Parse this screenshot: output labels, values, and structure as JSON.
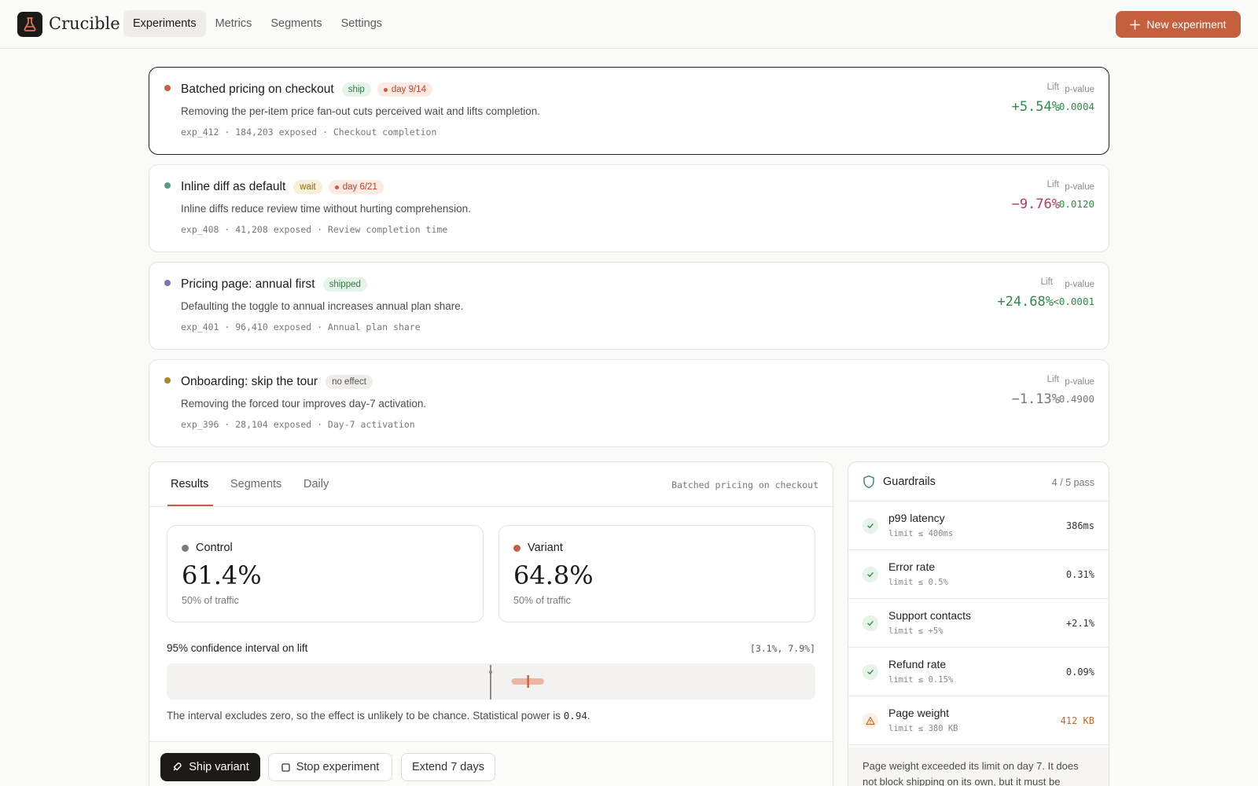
{
  "app": {
    "name": "Crucible"
  },
  "nav": {
    "tabs": [
      {
        "label": "Experiments",
        "active": true
      },
      {
        "label": "Metrics",
        "active": false
      },
      {
        "label": "Segments",
        "active": false
      },
      {
        "label": "Settings",
        "active": false
      }
    ],
    "new_button": "New experiment"
  },
  "experiments": [
    {
      "title": "Batched pricing on checkout",
      "status": "ship",
      "day": "day 9/14",
      "description": "Removing the per-item price fan-out cuts perceived wait and lifts completion.",
      "meta": "exp_412 · 184,203 exposed · Checkout completion",
      "lift_label": "Lift",
      "lift": "+5.54%",
      "p_label": "p-value",
      "p_value": "0.0004",
      "dot_color": "#c4603e",
      "lift_color": "#2e8a4b",
      "p_color": "#2e8a4b"
    },
    {
      "title": "Inline diff as default",
      "status": "wait",
      "day": "day 6/21",
      "description": "Inline diffs reduce review time without hurting comprehension.",
      "meta": "exp_408 · 41,208 exposed · Review completion time",
      "lift_label": "Lift",
      "lift": "−9.76%",
      "p_label": "p-value",
      "p_value": "0.0120",
      "dot_color": "#5a9a86",
      "lift_color": "#b8375e",
      "p_color": "#2e8a4b"
    },
    {
      "title": "Pricing page: annual first",
      "status": "shipped",
      "day": "",
      "description": "Defaulting the toggle to annual increases annual plan share.",
      "meta": "exp_401 · 96,410 exposed · Annual plan share",
      "lift_label": "Lift",
      "lift": "+24.68%",
      "p_label": "p-value",
      "p_value": "<0.0001",
      "dot_color": "#7f72b0",
      "lift_color": "#2e8a4b",
      "p_color": "#2e8a4b"
    },
    {
      "title": "Onboarding: skip the tour",
      "status": "no effect",
      "day": "",
      "description": "Removing the forced tour improves day-7 activation.",
      "meta": "exp_396 · 28,104 exposed · Day-7 activation",
      "lift_label": "Lift",
      "lift": "−1.13%",
      "p_label": "p-value",
      "p_value": "0.4900",
      "dot_color": "#a8882a",
      "lift_color": "#777777",
      "p_color": "#777777"
    }
  ],
  "results": {
    "tabs": [
      {
        "label": "Results",
        "active": true
      },
      {
        "label": "Segments",
        "active": false
      },
      {
        "label": "Daily",
        "active": false
      }
    ],
    "selected_experiment": "Batched pricing on checkout",
    "control": {
      "label": "Control",
      "value": "61.4%",
      "traffic": "50% of traffic",
      "color": "#7a7a7a"
    },
    "variant": {
      "label": "Variant",
      "value": "64.8%",
      "traffic": "50% of traffic",
      "color": "#c4603e"
    },
    "ci": {
      "label": "95% confidence interval on lift",
      "range": "[3.1%, 7.9%]",
      "low": 3.1,
      "high": 7.9,
      "point": 5.54
    },
    "note_prefix": "The interval excludes zero, so the effect is unlikely to be chance. Statistical power is ",
    "power": "0.94",
    "note_suffix": ".",
    "actions": {
      "ship": "Ship variant",
      "stop": "Stop experiment",
      "extend": "Extend 7 days"
    }
  },
  "guardrails": {
    "title": "Guardrails",
    "count": "4 / 5 pass",
    "items": [
      {
        "name": "p99 latency",
        "limit": "limit ≤ 400ms",
        "value": "386ms",
        "status": "ok"
      },
      {
        "name": "Error rate",
        "limit": "limit ≤ 0.5%",
        "value": "0.31%",
        "status": "ok"
      },
      {
        "name": "Support contacts",
        "limit": "limit ≤ +5%",
        "value": "+2.1%",
        "status": "ok"
      },
      {
        "name": "Refund rate",
        "limit": "limit ≤ 0.15%",
        "value": "0.09%",
        "status": "ok"
      },
      {
        "name": "Page weight",
        "limit": "limit ≤ 380 KB",
        "value": "412 KB",
        "status": "warn"
      }
    ],
    "note": "Page weight exceeded its limit on day 7. It does not block shipping on its own, but it must be"
  }
}
